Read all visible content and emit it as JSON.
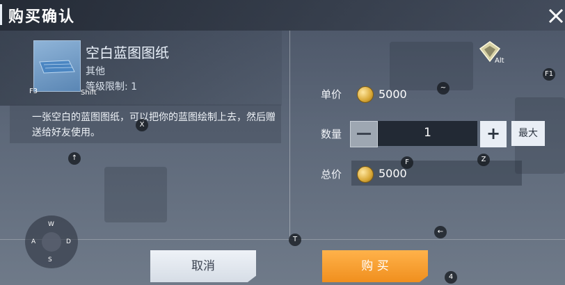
{
  "dialog": {
    "title": "购买确认",
    "close_icon": "close-x-icon"
  },
  "item": {
    "name": "空白蓝图图纸",
    "category": "其他",
    "level_limit": "等级限制: 1",
    "description": "一张空白的蓝图图纸，可以把你的蓝图绘制上去，然后赠送给好友使用。"
  },
  "purchase": {
    "unit_price_label": "单价",
    "unit_price": "5000",
    "quantity_label": "数量",
    "quantity": "1",
    "max_label": "最大",
    "total_label": "总价",
    "total_price": "5000",
    "currency_icon": "gold-coin-icon"
  },
  "buttons": {
    "cancel": "取消",
    "buy": "购 买"
  },
  "key_hints": {
    "f3": "F3",
    "shift": "Shift",
    "alt": "Alt",
    "f1": "F1",
    "tilde": "~",
    "x": "X",
    "up": "↑",
    "f": "F",
    "z": "Z",
    "t": "T",
    "left": "←",
    "four": "4",
    "w": "W",
    "a": "A",
    "s": "S",
    "d": "D"
  },
  "colors": {
    "buy_button": "#f08f1e",
    "cancel_button": "#e9eef5",
    "coin": "#d9a836"
  }
}
